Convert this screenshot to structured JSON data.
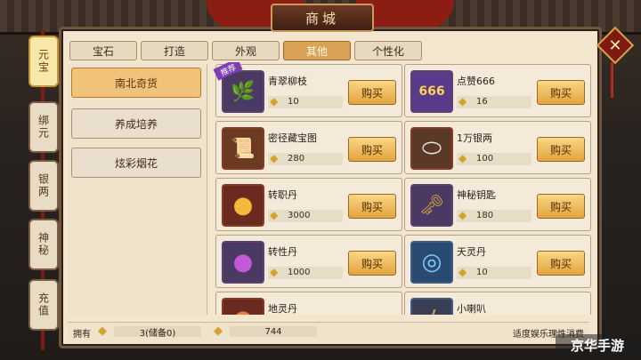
{
  "window": {
    "title": "商城"
  },
  "side_tabs": [
    {
      "label": "元宝",
      "active": true
    },
    {
      "label": "绑元",
      "active": false
    },
    {
      "label": "银两",
      "active": false
    },
    {
      "label": "神秘",
      "active": false
    },
    {
      "label": "充值",
      "active": false
    }
  ],
  "top_tabs": [
    {
      "label": "宝石"
    },
    {
      "label": "打造"
    },
    {
      "label": "外观"
    },
    {
      "label": "其他",
      "active": true
    },
    {
      "label": "个性化"
    }
  ],
  "categories": [
    {
      "label": "南北奇货",
      "active": true
    },
    {
      "label": "养成培养"
    },
    {
      "label": "炫彩烟花"
    }
  ],
  "items": [
    {
      "name": "青翠柳枝",
      "price": "10",
      "buy_label": "购买",
      "badge": "推荐",
      "icon": "willow-branch-icon",
      "icon_glyph": "🌿"
    },
    {
      "name": "点赞666",
      "price": "16",
      "buy_label": "购买",
      "icon": "like-666-icon",
      "icon_glyph": "666"
    },
    {
      "name": "密径藏宝图",
      "price": "280",
      "buy_label": "购买",
      "icon": "treasure-map-icon",
      "icon_glyph": "📜"
    },
    {
      "name": "1万银两",
      "price": "100",
      "buy_label": "购买",
      "icon": "silver-ingot-icon",
      "icon_glyph": "⬭"
    },
    {
      "name": "转职丹",
      "price": "3000",
      "buy_label": "购买",
      "icon": "job-change-pill-icon",
      "icon_glyph": "●"
    },
    {
      "name": "神秘钥匙",
      "price": "180",
      "buy_label": "购买",
      "icon": "mystery-key-icon",
      "icon_glyph": "🗝"
    },
    {
      "name": "转性丹",
      "price": "1000",
      "buy_label": "购买",
      "icon": "gender-change-pill-icon",
      "icon_glyph": "●"
    },
    {
      "name": "天灵丹",
      "price": "10",
      "buy_label": "购买",
      "icon": "sky-spirit-pill-icon",
      "icon_glyph": "◎"
    },
    {
      "name": "地灵丹",
      "icon": "earth-spirit-pill-icon",
      "icon_glyph": "●"
    },
    {
      "name": "小喇叭",
      "icon": "horn-icon",
      "icon_glyph": "/"
    }
  ],
  "bottom": {
    "own_label": "拥有",
    "gold_amount": "3(储备0)",
    "bound_amount": "744",
    "notice": "适度娱乐理性消费"
  },
  "watermark": "京华手游",
  "close_label": "✕",
  "colors": {
    "accent": "#d9a256",
    "buy_button": "#e3a43c",
    "frame_red": "#8c1d12"
  }
}
